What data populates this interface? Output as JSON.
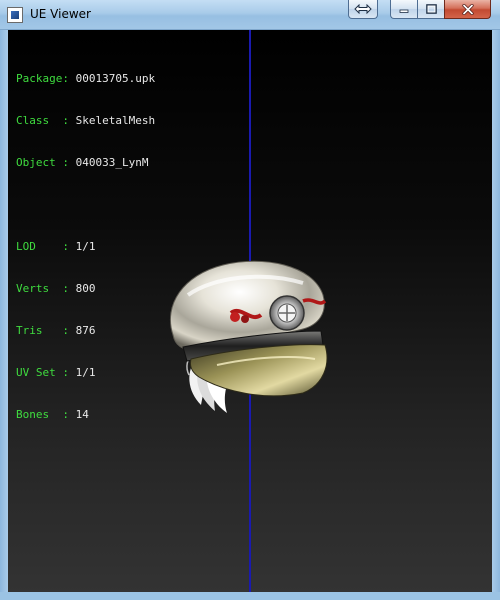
{
  "window": {
    "title": "UE Viewer"
  },
  "titlebar_buttons": {
    "swap_icon": "swap-arrows-icon",
    "minimize_icon": "minimize-icon",
    "maximize_icon": "maximize-icon",
    "close_icon": "close-icon"
  },
  "info": {
    "package": {
      "label": "Package:",
      "value": "00013705.upk"
    },
    "class": {
      "label": "Class  :",
      "value": "SkeletalMesh"
    },
    "object": {
      "label": "Object :",
      "value": "040033_LynM"
    },
    "lod": {
      "label": "LOD    :",
      "value": "1/1"
    },
    "verts": {
      "label": "Verts  :",
      "value": "800"
    },
    "tris": {
      "label": "Tris   :",
      "value": "876"
    },
    "uvset": {
      "label": "UV Set :",
      "value": "1/1"
    },
    "bones": {
      "label": "Bones  :",
      "value": "14"
    }
  },
  "colors": {
    "label_green": "#3fdc3f",
    "value_white": "#e8e8e8",
    "axis_blue": "#1a1ab0"
  }
}
